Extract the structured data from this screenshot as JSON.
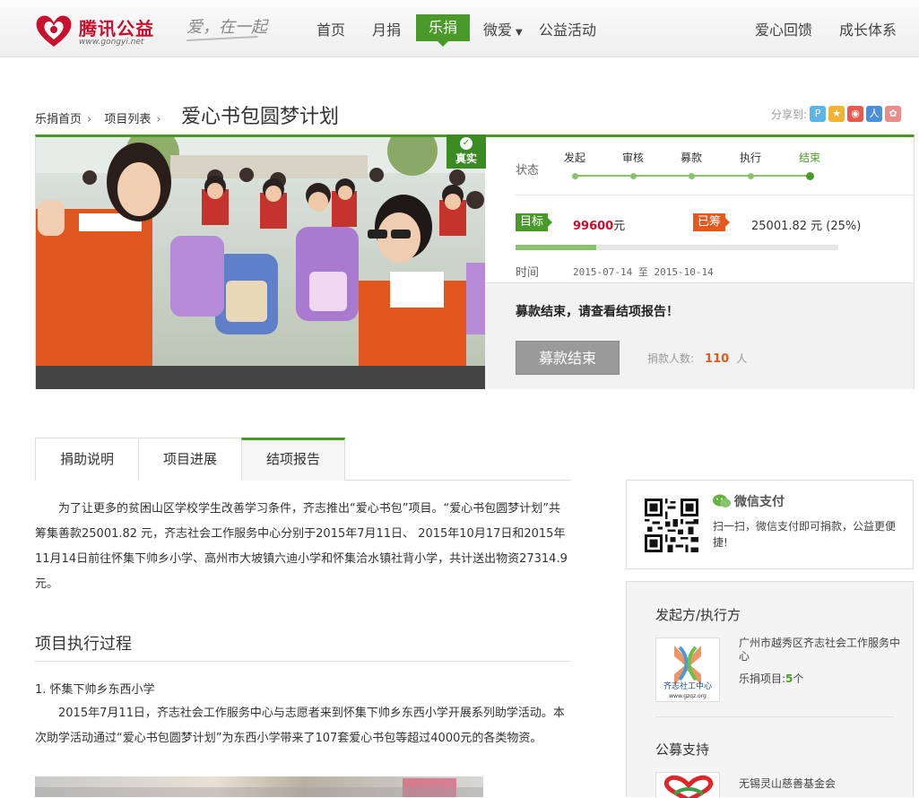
{
  "header": {
    "logo_text": "腾讯公益",
    "logo_url": "www.gongyi.net",
    "slogan": "爱，在一起",
    "nav": [
      "首页",
      "月捐",
      "乐捐",
      "微爱",
      "公益活动"
    ],
    "nav_right": [
      "爱心回馈",
      "成长体系"
    ]
  },
  "breadcrumb": [
    "乐捐首页",
    "项目列表"
  ],
  "project": {
    "title": "爱心书包圆梦计划",
    "share_label": "分享到:",
    "verified": "真实",
    "status_label": "状态",
    "steps": [
      "发起",
      "审核",
      "募款",
      "执行",
      "结束"
    ],
    "current_step": 4,
    "target_tag": "目标",
    "target_amount": "99600",
    "target_unit": "元",
    "raised_tag": "已筹",
    "raised_amount": "25001.82 元 (25%)",
    "progress": 0.25,
    "time_label": "时间",
    "start_date": "2015-07-14",
    "date_sep": "至",
    "end_date": "2015-10-14",
    "end_notice": "募款结束，请查看结项报告！",
    "end_button": "募款结束",
    "donors_label": "捐款人数:",
    "donors_count": "110",
    "donors_unit": "人"
  },
  "tabs": [
    "捐助说明",
    "项目进展",
    "结项报告"
  ],
  "active_tab": 2,
  "content": {
    "intro": "为了让更多的贫困山区学校学生改善学习条件，齐志推出“爱心书包”项目。“爱心书包圆梦计划”共筹集善款25001.82 元，齐志社会工作服务中心分别于2015年7月11日、 2015年10月17日和2015年11月14日前往怀集下帅乡小学、高州市大坡镇六迪小学和怀集洽水镇社背小学，共计送出物资27314.9元。",
    "section_title": "项目执行过程",
    "item1_title": "1.  怀集下帅乡东西小学",
    "item1_text": "2015年7月11日，齐志社会工作服务中心与志愿者来到怀集下帅乡东西小学开展系列助学活动。本次助学活动通过“爱心书包圆梦计划”为东西小学带来了107套爱心书包等超过4000元的各类物资。"
  },
  "wechat": {
    "title": "微信支付",
    "desc": "扫一扫，微信支付即可捐款，公益更便捷!"
  },
  "sidebar": {
    "organizer_title": "发起方/执行方",
    "org_logo_text": "齐志社工中心",
    "org_logo_url": "www.gzqz.org",
    "org_name": "广州市越秀区齐志社会工作服务中心",
    "org_projects_label": "乐捐项目:",
    "org_projects_count": "5",
    "org_projects_unit": "个",
    "fund_title": "公募支持",
    "fund_name": "无锡灵山慈善基金会"
  },
  "colors": {
    "brand_green": "#4a9a2a",
    "brand_red": "#c8102e",
    "accent_orange": "#e45a1e"
  }
}
